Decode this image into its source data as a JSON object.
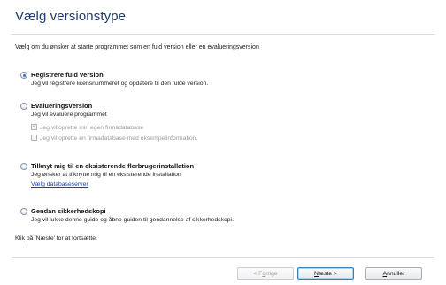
{
  "dialog": {
    "title": "Vælg versionstype",
    "intro": "Vælg om du ønsker at starte programmet som en fuld version  eller en evalueringsversion"
  },
  "options": {
    "full": {
      "title": "Registrere fuld version",
      "desc": "Jeg vil registrere licensnummeret og opdatere til den fulde version.",
      "checked": true
    },
    "evaluation": {
      "title": "Evalueringsversion",
      "desc": "Jeg vil evaluere programmet",
      "checkbox1": "Jeg vil oprette min egen firmadatabase",
      "checkbox1_checked": true,
      "checkbox2": "Jeg vil oprette en firmadatabase med eksempelinformation.",
      "checkbox2_checked": false
    },
    "multiuser": {
      "title": "Tilknyt mig til en eksisterende flerbrugerinstallation",
      "desc": "Jeg ønsker at tilknytte mig til en eksisterende installation",
      "link": "Vælg databaseserver"
    },
    "restore": {
      "title": "Gendan sikkerhedskopi",
      "desc": "Jeg vil lukke denne guide og åbne guiden til gendannelse af sikkerhedskopi."
    }
  },
  "footer": {
    "hint": "Klik på 'Næste' for at fortsætte."
  },
  "buttons": {
    "back_pre": "< F",
    "back_u": "o",
    "back_post": "rrige",
    "next_u": "N",
    "next_post": "æste >",
    "cancel_u": "A",
    "cancel_post": "nnuller"
  }
}
